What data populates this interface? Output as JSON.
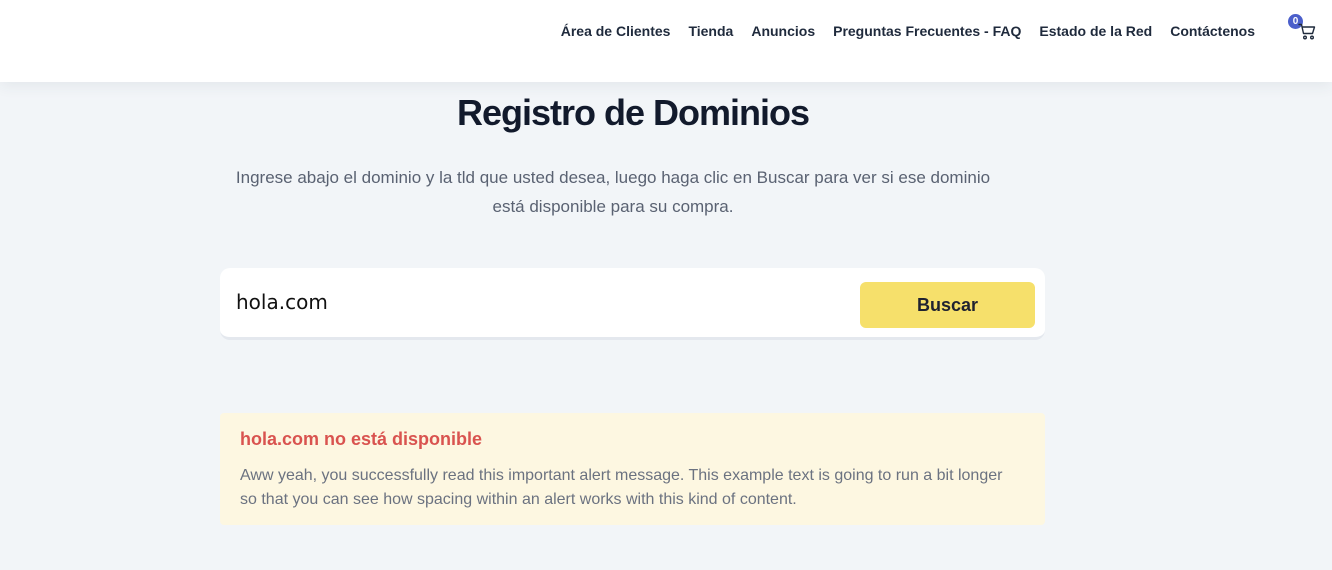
{
  "nav": {
    "items": [
      {
        "label": "Área de Clientes"
      },
      {
        "label": "Tienda"
      },
      {
        "label": "Anuncios"
      },
      {
        "label": "Preguntas Frecuentes - FAQ"
      },
      {
        "label": "Estado de la Red"
      },
      {
        "label": "Contáctenos"
      }
    ],
    "cart_count": "0",
    "cart_icon": "shopping-cart-icon"
  },
  "page": {
    "title": "Registro de Dominios",
    "lead": "Ingrese abajo el dominio y la tld que usted desea, luego haga clic en Buscar para ver si ese dominio está disponible para su compra."
  },
  "search": {
    "value": "hola.com",
    "button_label": "Buscar"
  },
  "alert": {
    "title": "hola.com no está disponible",
    "text": "Aww yeah, you successfully read this important alert message. This example text is going to run a bit longer so that you can see how spacing within an alert works with this kind of content."
  },
  "colors": {
    "accent_button": "#f6e06b",
    "alert_title": "#d9534f",
    "alert_background": "#fdf7e1",
    "badge": "#4b5fcb"
  }
}
